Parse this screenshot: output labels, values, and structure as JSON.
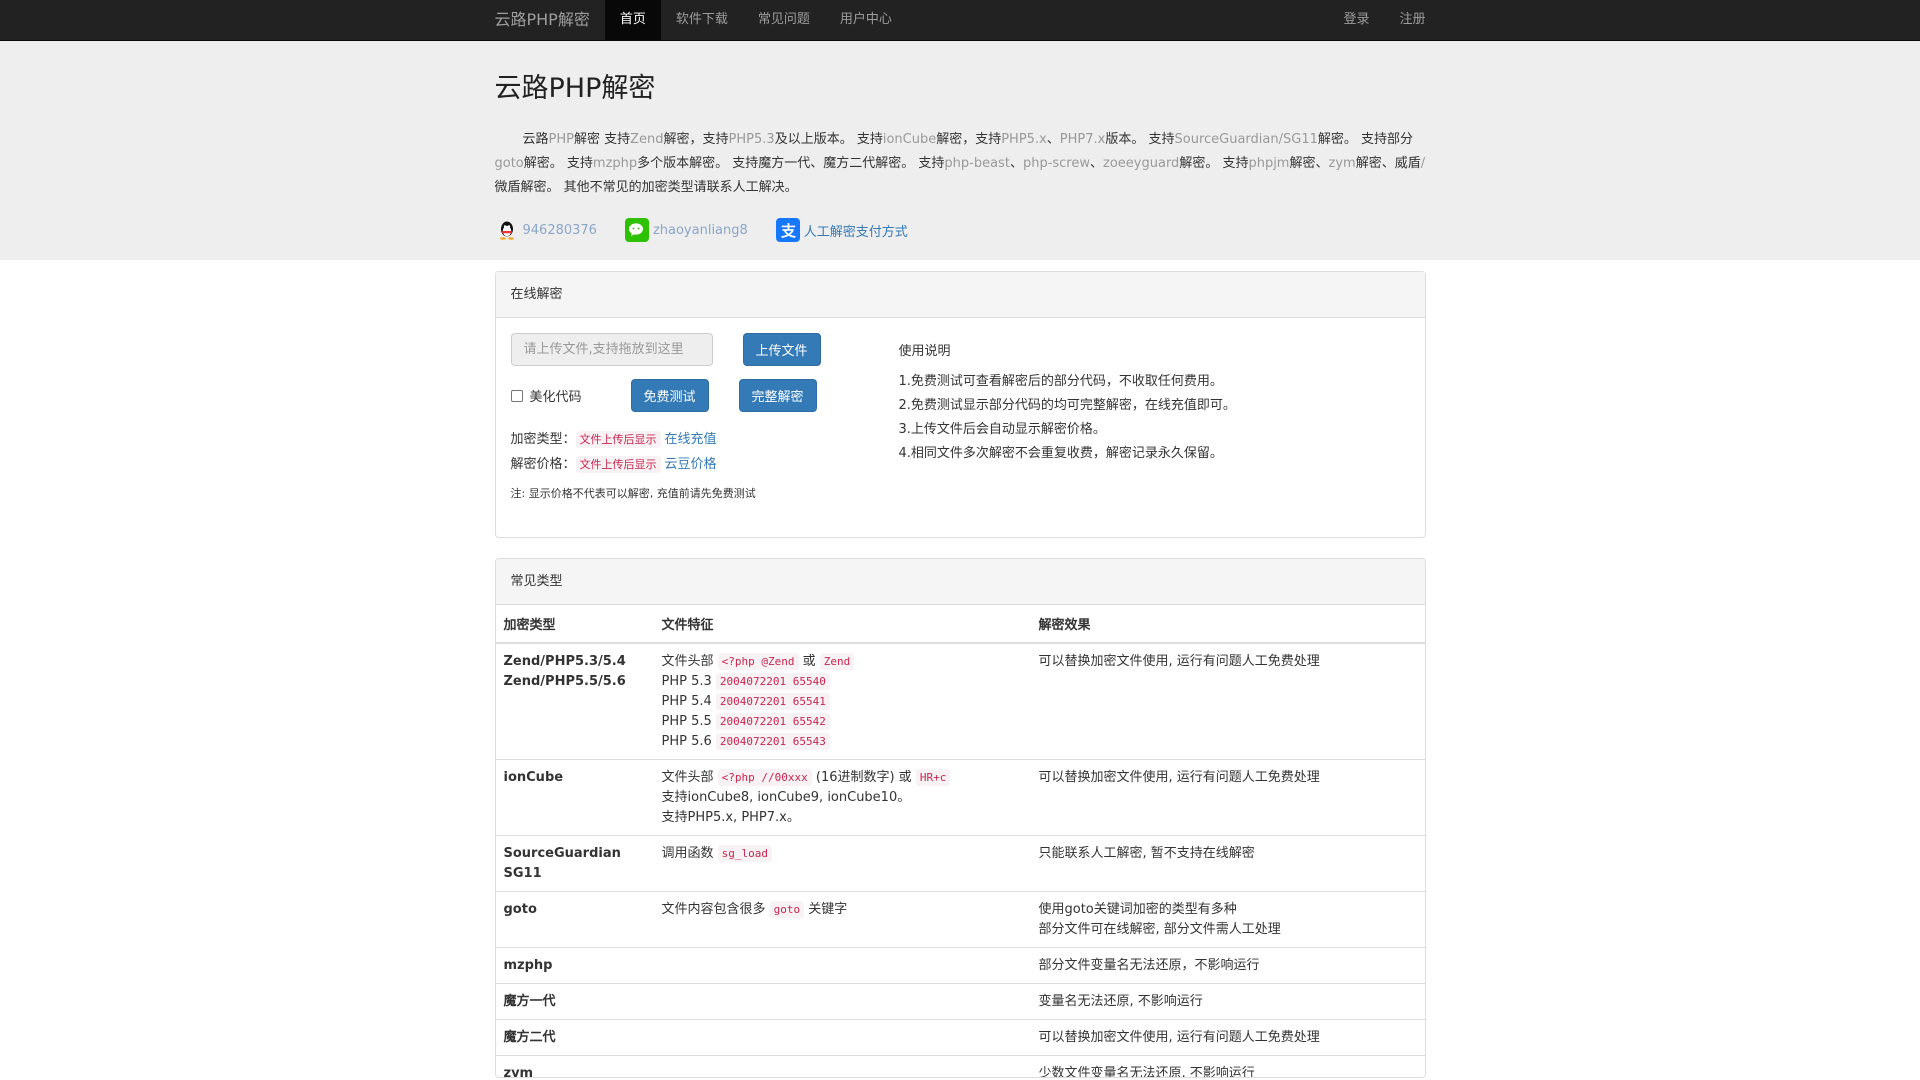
{
  "nav": {
    "brand": "云路PHP解密",
    "links": [
      "首页",
      "软件下载",
      "常见问题",
      "用户中心"
    ],
    "right": [
      "登录",
      "注册"
    ]
  },
  "hero": {
    "title": "云路PHP解密",
    "intro": [
      {
        "t": "云路",
        "m": false
      },
      {
        "t": "PHP",
        "m": true
      },
      {
        "t": "解密 支持",
        "m": false
      },
      {
        "t": "Zend",
        "m": true
      },
      {
        "t": "解密，支持",
        "m": false
      },
      {
        "t": "PHP5.3",
        "m": true
      },
      {
        "t": "及以上版本。 支持",
        "m": false
      },
      {
        "t": "ionCube",
        "m": true
      },
      {
        "t": "解密，支持",
        "m": false
      },
      {
        "t": "PHP5.x",
        "m": true
      },
      {
        "t": "、",
        "m": false
      },
      {
        "t": "PHP7.x",
        "m": true
      },
      {
        "t": "版本。 支持",
        "m": false
      },
      {
        "t": "SourceGuardian/SG11",
        "m": true
      },
      {
        "t": "解密。 支持部分",
        "m": false
      },
      {
        "t": "goto",
        "m": true
      },
      {
        "t": "解密。 支持",
        "m": false
      },
      {
        "t": "mzphp",
        "m": true
      },
      {
        "t": "多个版本解密。 支持魔方一代、魔方二代解密。 支持",
        "m": false
      },
      {
        "t": "php-beast",
        "m": true
      },
      {
        "t": "、",
        "m": false
      },
      {
        "t": "php-screw",
        "m": true
      },
      {
        "t": "、",
        "m": false
      },
      {
        "t": "zoeeyguard",
        "m": true
      },
      {
        "t": "解密。 支持",
        "m": false
      },
      {
        "t": "phpjm",
        "m": true
      },
      {
        "t": "解密、",
        "m": false
      },
      {
        "t": "zym",
        "m": true
      },
      {
        "t": "解密、威盾",
        "m": false
      },
      {
        "t": "/",
        "m": true
      },
      {
        "t": "微盾解密。 其他不常见的加密类型请联系人工解决。",
        "m": false
      }
    ],
    "qq": "946280376",
    "wechat": "zhaoyanliang8",
    "pay_link": "人工解密支付方式"
  },
  "online": {
    "heading": "在线解密",
    "upload_placeholder": "请上传文件,支持拖放到这里",
    "upload_button": "上传文件",
    "beautify_label": "美化代码",
    "free_test_button": "免费测试",
    "full_decrypt_button": "完整解密",
    "enc_type_label": "加密类型：",
    "enc_type_value": "文件上传后显示",
    "recharge_link": "在线充值",
    "price_label": "解密价格：",
    "price_value": "文件上传后显示",
    "price_link": "云豆价格",
    "note": "注: 显示价格不代表可以解密, 充值前请先免费测试",
    "usage_title": "使用说明",
    "usage_lines": [
      "1.免费测试可查看解密后的部分代码，不收取任何费用。",
      "2.免费测试显示部分代码的均可完整解密，在线充值即可。",
      "3.上传文件后会自动显示解密价格。",
      "4.相同文件多次解密不会重复收费，解密记录永久保留。"
    ]
  },
  "types": {
    "heading": "常见类型",
    "columns": [
      "加密类型",
      "文件特征",
      "解密效果"
    ],
    "rows": [
      {
        "name": [
          "Zend/PHP5.3/5.4",
          "Zend/PHP5.5/5.6"
        ],
        "features": [
          [
            {
              "t": "文件头部 "
            },
            {
              "c": "<?php @Zend"
            },
            {
              "t": " 或 "
            },
            {
              "c": "Zend"
            }
          ],
          [
            {
              "t": "PHP 5.3 "
            },
            {
              "c": "2004072201 65540"
            }
          ],
          [
            {
              "t": "PHP 5.4 "
            },
            {
              "c": "2004072201 65541"
            }
          ],
          [
            {
              "t": "PHP 5.5 "
            },
            {
              "c": "2004072201 65542"
            }
          ],
          [
            {
              "t": "PHP 5.6 "
            },
            {
              "c": "2004072201 65543"
            }
          ]
        ],
        "effect": [
          "可以替换加密文件使用, 运行有问题人工免费处理"
        ]
      },
      {
        "name": [
          "ionCube"
        ],
        "features": [
          [
            {
              "t": "文件头部 "
            },
            {
              "c": "<?php //00xxx"
            },
            {
              "t": " (16进制数字) 或 "
            },
            {
              "c": "HR+c"
            }
          ],
          [
            {
              "t": "支持ionCube8, ionCube9, ionCube10。"
            }
          ],
          [
            {
              "t": "支持PHP5.x, PHP7.x。"
            }
          ]
        ],
        "effect": [
          "可以替换加密文件使用, 运行有问题人工免费处理"
        ]
      },
      {
        "name": [
          "SourceGuardian",
          "SG11"
        ],
        "features": [
          [
            {
              "t": "调用函数 "
            },
            {
              "c": "sg_load"
            }
          ]
        ],
        "effect": [
          "只能联系人工解密, 暂不支持在线解密"
        ]
      },
      {
        "name": [
          "goto"
        ],
        "features": [
          [
            {
              "t": "文件内容包含很多 "
            },
            {
              "c": "goto"
            },
            {
              "t": " 关键字"
            }
          ]
        ],
        "effect": [
          "使用goto关键词加密的类型有多种",
          "部分文件可在线解密, 部分文件需人工处理"
        ]
      },
      {
        "name": [
          "mzphp"
        ],
        "features": [],
        "effect": [
          "部分文件变量名无法还原，不影响运行"
        ]
      },
      {
        "name": [
          "魔方一代"
        ],
        "features": [],
        "effect": [
          "变量名无法还原, 不影响运行"
        ]
      },
      {
        "name": [
          "魔方二代"
        ],
        "features": [],
        "effect": [
          "可以替换加密文件使用, 运行有问题人工免费处理"
        ]
      },
      {
        "name": [
          "zym"
        ],
        "features": [],
        "effect": [
          "少数文件变量名无法还原, 不影响运行"
        ]
      }
    ]
  },
  "colors": {
    "navbar": "#222222",
    "primary": "#337ab7",
    "code": "#c7254e",
    "jumbotron": "#eeeeee"
  }
}
